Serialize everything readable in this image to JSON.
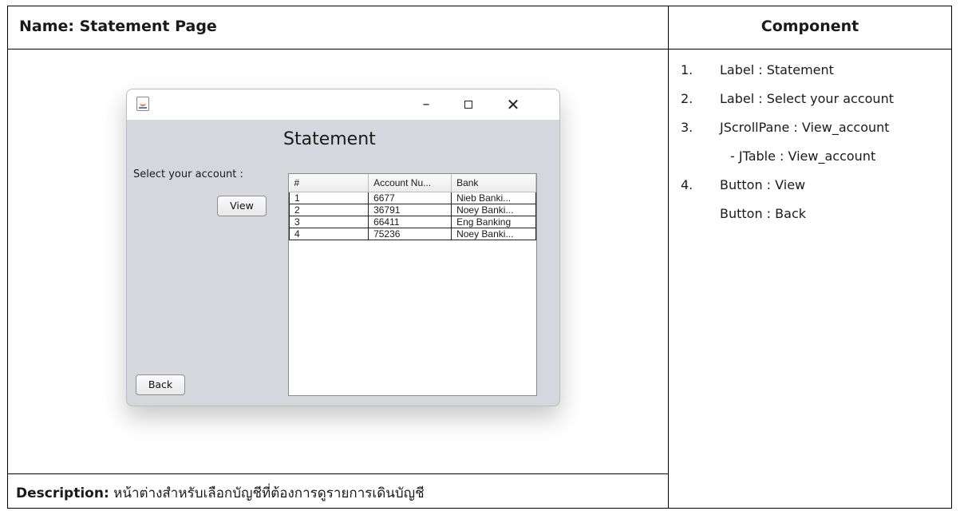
{
  "header": {
    "name_label": "Name: Statement Page",
    "component_label": "Component"
  },
  "description": {
    "label": "Description:",
    "text": "หน้าต่างสำหรับเลือกบัญชีที่ต้องการดูรายการเดินบัญชี"
  },
  "components": [
    {
      "num": "1.",
      "text": "Label : Statement"
    },
    {
      "num": "2.",
      "text": "Label : Select your account"
    },
    {
      "num": "3.",
      "text": "JScrollPane : View_account"
    },
    {
      "num": "",
      "text": "- JTable : View_account"
    },
    {
      "num": "4.",
      "text": "Button : View"
    },
    {
      "num": "",
      "text": "Button : Back"
    }
  ],
  "window": {
    "title": "Statement",
    "select_label": "Select your account :",
    "view_button": "View",
    "back_button": "Back",
    "controls": {
      "minimize": "–",
      "close": "✕"
    },
    "table": {
      "columns": [
        "#",
        "Account Nu...",
        "Bank"
      ],
      "rows": [
        [
          "1",
          "6677",
          "Nieb Banki..."
        ],
        [
          "2",
          "36791",
          "Noey Banki..."
        ],
        [
          "3",
          "66411",
          "Eng Banking"
        ],
        [
          "4",
          "75236",
          "Noey Banki..."
        ]
      ]
    }
  }
}
